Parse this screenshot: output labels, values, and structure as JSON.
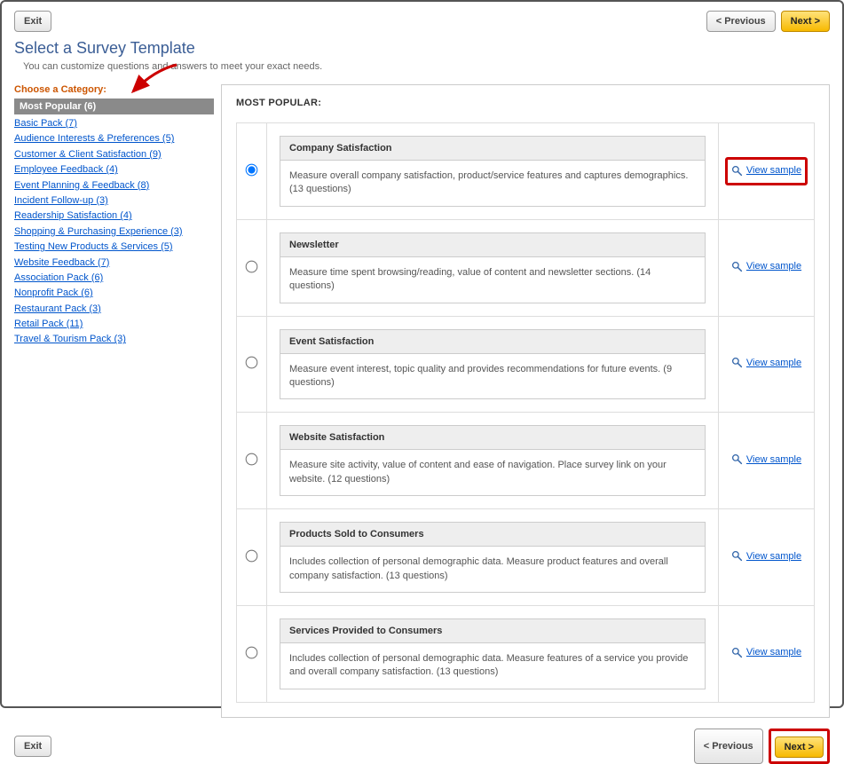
{
  "buttons": {
    "exit": "Exit",
    "previous": "< Previous",
    "next": "Next >"
  },
  "heading": "Select a Survey Template",
  "subheading": "You can customize questions and answers to meet your exact needs.",
  "choose_label": "Choose a Category:",
  "selected_category": "Most Popular (6)",
  "categories": [
    "Basic Pack (7)",
    "Audience Interests & Preferences (5)",
    "Customer & Client Satisfaction (9)",
    "Employee Feedback (4)",
    "Event Planning & Feedback (8)",
    "Incident Follow-up (3)",
    "Readership Satisfaction (4)",
    "Shopping & Purchasing Experience (3)",
    "Testing New Products & Services (5)",
    "Website Feedback (7)",
    "Association Pack (6)",
    "Nonprofit Pack (6)",
    "Restaurant Pack (3)",
    "Retail Pack (11)",
    "Travel & Tourism Pack (3)"
  ],
  "content_heading": "MOST POPULAR:",
  "view_sample_label": "View sample",
  "templates": [
    {
      "title": "Company Satisfaction",
      "desc": "Measure overall company satisfaction, product/service features and captures demographics. (13 questions)",
      "selected": true,
      "highlighted": true
    },
    {
      "title": "Newsletter",
      "desc": "Measure time spent browsing/reading, value of content and newsletter sections. (14 questions)",
      "selected": false,
      "highlighted": false
    },
    {
      "title": "Event Satisfaction",
      "desc": "Measure event interest, topic quality and provides recommendations for future events. (9 questions)",
      "selected": false,
      "highlighted": false
    },
    {
      "title": "Website Satisfaction",
      "desc": "Measure site activity, value of content and ease of navigation. Place survey link on your website. (12 questions)",
      "selected": false,
      "highlighted": false
    },
    {
      "title": "Products Sold to Consumers",
      "desc": "Includes collection of personal demographic data. Measure product features and overall company satisfaction. (13 questions)",
      "selected": false,
      "highlighted": false
    },
    {
      "title": "Services Provided to Consumers",
      "desc": "Includes collection of personal demographic data. Measure features of a service you provide and overall company satisfaction. (13 questions)",
      "selected": false,
      "highlighted": false
    }
  ]
}
